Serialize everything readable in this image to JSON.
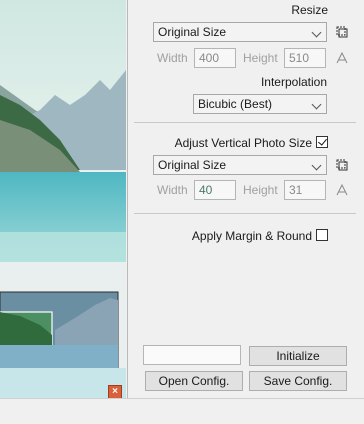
{
  "resize": {
    "label": "Resize",
    "mode": "Original Size",
    "width_label": "Width",
    "width_value": "400",
    "height_label": "Height",
    "height_value": "510"
  },
  "interpolation": {
    "label": "Interpolation",
    "value": "Bicubic (Best)"
  },
  "vertical": {
    "label": "Adjust Vertical Photo Size",
    "checked": true,
    "mode": "Original Size",
    "width_label": "Width",
    "width_value": "40",
    "height_label": "Height",
    "height_value": "31"
  },
  "margin": {
    "label": "Apply Margin & Round",
    "checked": false
  },
  "buttons": {
    "initialize": "Initialize",
    "open_config": "Open Config.",
    "save_config": "Save Config."
  },
  "preview": {
    "close_glyph": "×"
  },
  "icons": {
    "crop": "crop-frame-icon",
    "link": "aspect-link-icon"
  }
}
